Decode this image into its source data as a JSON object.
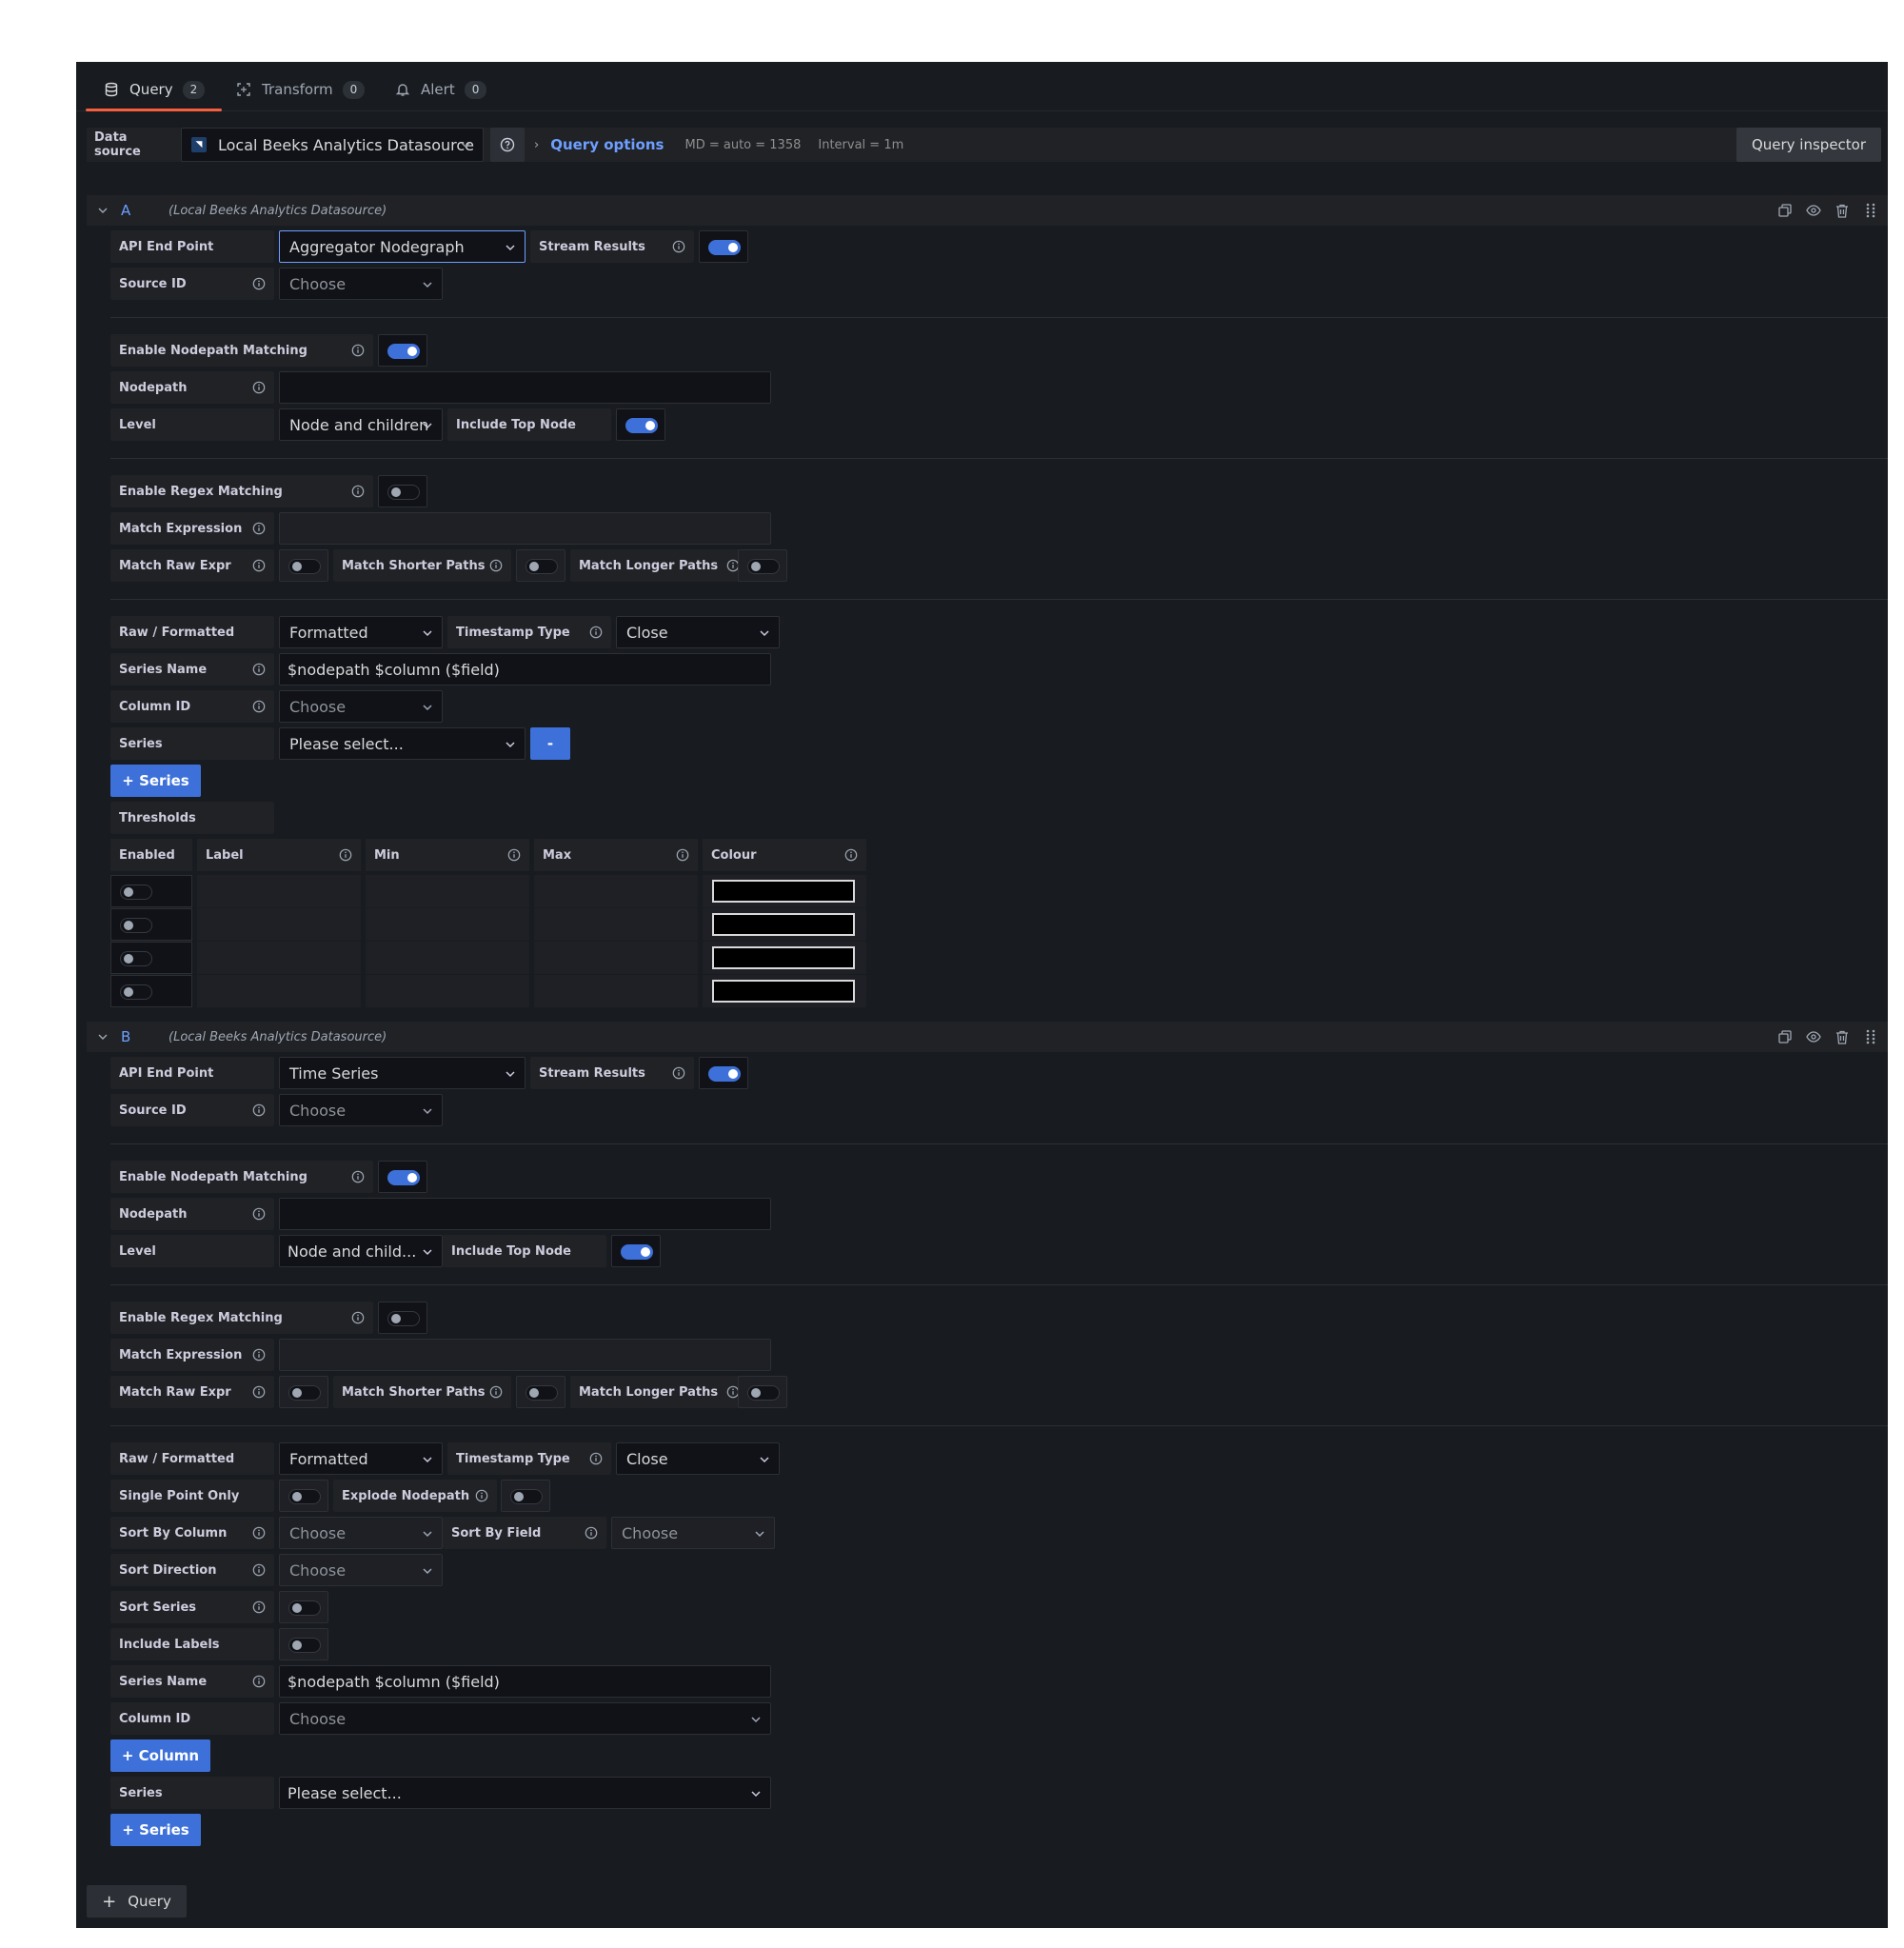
{
  "tabs": [
    {
      "label": "Query",
      "count": "2"
    },
    {
      "label": "Transform",
      "count": "0"
    },
    {
      "label": "Alert",
      "count": "0"
    }
  ],
  "datasource": {
    "label": "Data source",
    "selected": "Local Beeks Analytics Datasource",
    "query_options_label": "Query options",
    "md": "MD = auto = 1358",
    "interval": "Interval = 1m",
    "inspector_label": "Query inspector"
  },
  "queryA": {
    "ref_id": "A",
    "ds_name": "(Local Beeks Analytics Datasource)",
    "api_end_point_label": "API End Point",
    "api_end_point_value": "Aggregator Nodegraph",
    "stream_results_label": "Stream Results",
    "source_id_label": "Source ID",
    "source_id_placeholder": "Choose",
    "enable_nodepath_label": "Enable Nodepath Matching",
    "nodepath_label": "Nodepath",
    "level_label": "Level",
    "level_value": "Node and children",
    "include_top_node_label": "Include Top Node",
    "enable_regex_label": "Enable Regex Matching",
    "match_expression_label": "Match Expression",
    "match_raw_expr_label": "Match Raw Expr",
    "match_shorter_label": "Match Shorter Paths",
    "match_longer_label": "Match Longer Paths",
    "raw_formatted_label": "Raw / Formatted",
    "raw_formatted_value": "Formatted",
    "timestamp_type_label": "Timestamp Type",
    "timestamp_type_value": "Close",
    "series_name_label": "Series Name",
    "series_name_value": "$nodepath $column ($field)",
    "column_id_label": "Column ID",
    "column_id_placeholder": "Choose",
    "series_label": "Series",
    "series_value": "Please select...",
    "remove_label": "-",
    "add_series_label": "+ Series",
    "thresholds_label": "Thresholds",
    "thresholds_headers": [
      "Enabled",
      "Label",
      "Min",
      "Max",
      "Colour"
    ]
  },
  "queryB": {
    "ref_id": "B",
    "ds_name": "(Local Beeks Analytics Datasource)",
    "api_end_point_label": "API End Point",
    "api_end_point_value": "Time Series",
    "stream_results_label": "Stream Results",
    "source_id_label": "Source ID",
    "source_id_placeholder": "Choose",
    "enable_nodepath_label": "Enable Nodepath Matching",
    "nodepath_label": "Nodepath",
    "level_label": "Level",
    "level_value": "Node and child...",
    "include_top_node_label": "Include Top Node",
    "enable_regex_label": "Enable Regex Matching",
    "match_expression_label": "Match Expression",
    "match_raw_expr_label": "Match Raw Expr",
    "match_shorter_label": "Match Shorter Paths",
    "match_longer_label": "Match Longer Paths",
    "raw_formatted_label": "Raw / Formatted",
    "raw_formatted_value": "Formatted",
    "timestamp_type_label": "Timestamp Type",
    "timestamp_type_value": "Close",
    "single_point_label": "Single Point Only",
    "explode_nodepath_label": "Explode Nodepath",
    "sort_by_column_label": "Sort By Column",
    "sort_by_column_placeholder": "Choose",
    "sort_by_field_label": "Sort By Field",
    "sort_by_field_placeholder": "Choose",
    "sort_direction_label": "Sort Direction",
    "sort_direction_placeholder": "Choose",
    "sort_series_label": "Sort Series",
    "include_labels_label": "Include Labels",
    "series_name_label": "Series Name",
    "series_name_value": "$nodepath $column ($field)",
    "column_id_label": "Column ID",
    "column_id_placeholder": "Choose",
    "add_column_label": "+ Column",
    "series_label": "Series",
    "series_value": "Please select...",
    "add_series_label": "+ Series"
  },
  "add_query_label": "Query",
  "colors": {
    "background": "#181b1f",
    "panel": "#202226",
    "input": "#111217",
    "accent_blue": "#3d71d9",
    "link_blue": "#6e9fff",
    "tab_underline": "#f55f3e"
  }
}
